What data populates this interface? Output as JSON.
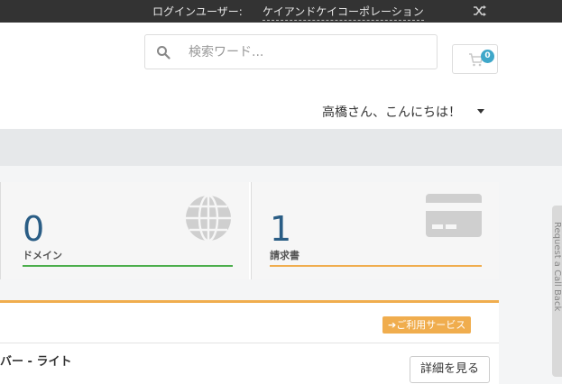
{
  "topbar": {
    "login_label": "ログインユーザー:",
    "company": "ケイアンドケイコーポレーション",
    "shuffle_icon": "shuffle-icon"
  },
  "header": {
    "search_placeholder": "検索ワード...",
    "cart_count": "0",
    "greeting": "高橋さん、こんにちは！"
  },
  "tiles": [
    {
      "count": "0",
      "label": "ドメイン",
      "icon": "globe-icon",
      "bar_color": "#4cae4c"
    },
    {
      "count": "1",
      "label": "請求書",
      "icon": "credit-card-icon",
      "bar_color": "#f0ad4e"
    }
  ],
  "panel": {
    "services_label": "➔ご利用サービス",
    "service_name": "バー - ライト",
    "detail_button": "詳細を見る"
  },
  "side_tab": {
    "label": "Request a Call Back"
  },
  "colors": {
    "accent": "#f0ad4e",
    "badge": "#3fa7c9",
    "count_text": "#2a5d85",
    "topbar": "#333333"
  }
}
